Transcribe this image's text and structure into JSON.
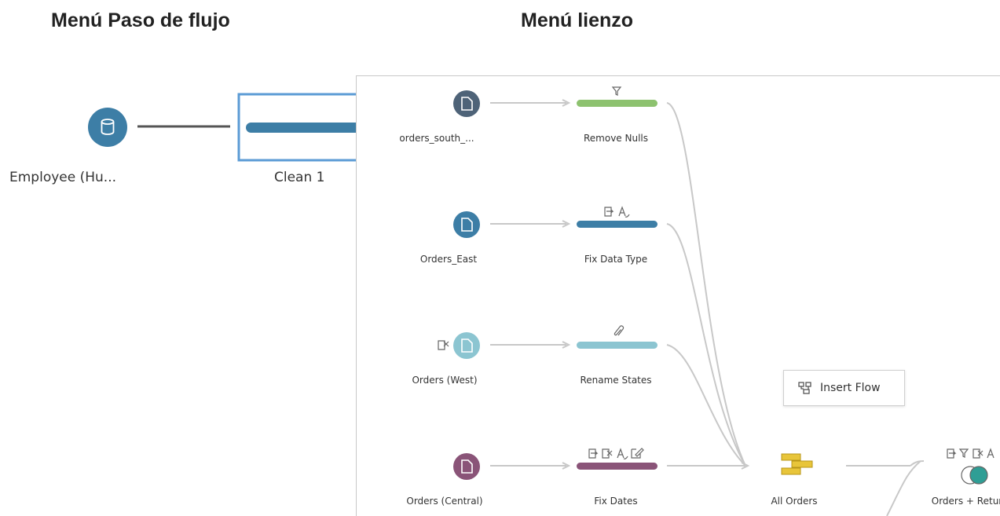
{
  "headings": {
    "flow_step_menu": "Menú Paso de flujo",
    "canvas_menu": "Menú lienzo"
  },
  "left_panel": {
    "input_node": {
      "label": "Employee (Hu...",
      "icon": "database-icon",
      "color": "#3d7ea6"
    },
    "clean_step": {
      "label": "Clean 1",
      "color": "#3d7ea6",
      "selected_border": "#5b9bd5"
    }
  },
  "canvas": {
    "inputs": [
      {
        "label": "orders_south_...",
        "icon": "file-icon",
        "color": "#4e6378"
      },
      {
        "label": "Orders_East",
        "icon": "file-icon",
        "color": "#3d7ea6"
      },
      {
        "label": "Orders (West)",
        "icon": "file-icon",
        "color": "#8cc5d1",
        "badge_icon": "remove-field-icon"
      },
      {
        "label": "Orders (Central)",
        "icon": "file-icon",
        "color": "#8a5478"
      }
    ],
    "steps": [
      {
        "label": "Remove Nulls",
        "color": "#8dc26f",
        "change_icons": [
          "filter-icon"
        ]
      },
      {
        "label": "Fix Data Type",
        "color": "#3d7ea6",
        "change_icons": [
          "rename-icon",
          "data-type-icon"
        ]
      },
      {
        "label": "Rename States",
        "color": "#8cc5d1",
        "change_icons": [
          "paperclip-icon"
        ]
      },
      {
        "label": "Fix Dates",
        "color": "#8a5478",
        "change_icons": [
          "rename-icon",
          "remove-icon",
          "data-type-icon",
          "edit-icon"
        ]
      }
    ],
    "union": {
      "label": "All Orders",
      "icon": "union-icon",
      "color": "#e8c53a"
    },
    "join": {
      "label": "Orders + Retur",
      "icon": "join-icon",
      "color": "#2f9e95",
      "change_icons": [
        "rename-icon",
        "filter-icon",
        "remove-icon",
        "data-type-icon"
      ]
    }
  },
  "context_menu": {
    "label": "Insert Flow",
    "icon": "insert-flow-icon"
  }
}
